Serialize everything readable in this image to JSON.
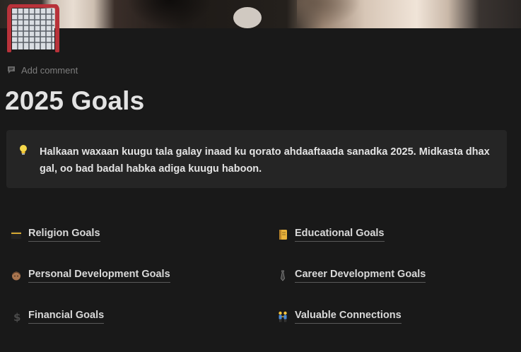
{
  "cover": {
    "description_icon": "cover-photo"
  },
  "page": {
    "icon": "goal-net-icon",
    "add_comment": "Add comment",
    "title": "2025 Goals"
  },
  "callout": {
    "icon": "light-bulb-icon",
    "text": "Halkaan waxaan kuugu tala galay inaad ku qorato ahdaaftaada sanadka 2025. Midkasta dhax gal, oo bad badal habka adiga kuugu haboon."
  },
  "links": [
    {
      "label": "Religion Goals",
      "icon": "kaaba-icon"
    },
    {
      "label": "Educational Goals",
      "icon": "notebook-icon"
    },
    {
      "label": "Personal Development Goals",
      "icon": "person-face-icon"
    },
    {
      "label": "Career Development Goals",
      "icon": "necktie-icon"
    },
    {
      "label": "Financial Goals",
      "icon": "dollar-sign-icon"
    },
    {
      "label": "Valuable Connections",
      "icon": "people-holding-hands-icon"
    }
  ],
  "colors": {
    "background": "#191919",
    "callout_bg": "#252525",
    "text": "#e3e3e3",
    "muted": "#7d7d7d"
  }
}
